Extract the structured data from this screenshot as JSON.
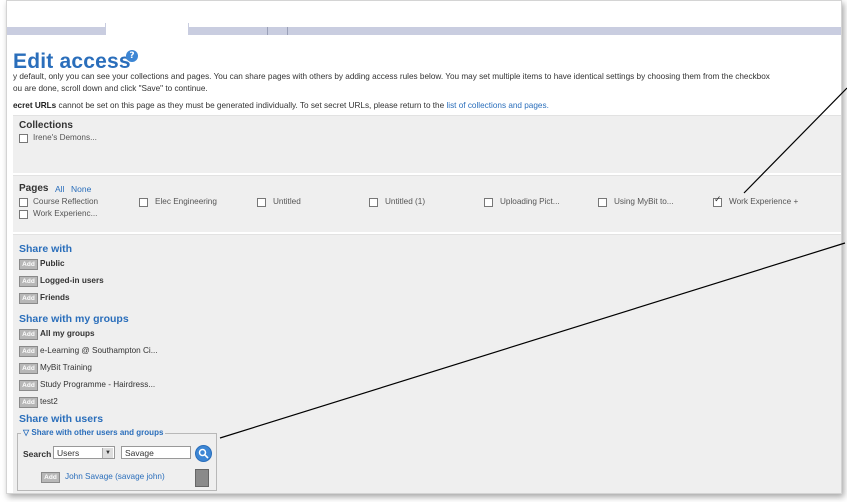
{
  "page": {
    "title": "Edit access",
    "info_icon": "?",
    "description_line1": "y default, only you can see your collections and pages. You can share pages with others by adding access rules below. You may set multiple items to have identical settings by choosing them from the checkbox",
    "description_line2": "ou are done, scroll down and click \"Save\" to continue.",
    "secret_bold": "ecret URLs",
    "secret_text": " cannot be set on this page as they must be generated individually. To set secret URLs, please return to the ",
    "secret_link": "list of collections and pages."
  },
  "collections": {
    "title": "Collections",
    "items": [
      {
        "label": "Irene's Demons...",
        "checked": false
      }
    ]
  },
  "pages": {
    "title": "Pages",
    "all_label": "All",
    "none_label": "None",
    "items": [
      {
        "label": "Course Reflection",
        "checked": false
      },
      {
        "label": "Elec Engineering",
        "checked": false
      },
      {
        "label": "Untitled",
        "checked": false
      },
      {
        "label": "Untitled (1)",
        "checked": false
      },
      {
        "label": "Uploading Pict...",
        "checked": false
      },
      {
        "label": "Using MyBit to...",
        "checked": false
      },
      {
        "label": "Work Experience +",
        "checked": true
      },
      {
        "label": "Work Experienc...",
        "checked": false
      }
    ]
  },
  "share_with": {
    "title": "Share with",
    "add_label": "Add",
    "items": [
      "Public",
      "Logged-in users",
      "Friends"
    ]
  },
  "share_groups": {
    "title": "Share with my groups",
    "items": [
      "All my groups",
      "e-Learning @ Southampton Ci...",
      "MyBit Training",
      "Study Programme - Hairdress...",
      "test2"
    ]
  },
  "share_users": {
    "title": "Share with users",
    "legend": "Share with other users and groups",
    "search_label": "Search",
    "search_type": "Users",
    "search_value": "Savage",
    "result_label": "John Savage (savage john)"
  },
  "icons": {
    "info": "info-icon",
    "search": "search-icon",
    "dropdown": "chevron-down-icon",
    "avatar": "avatar-icon"
  },
  "colors": {
    "accent": "#2a6ebb",
    "panel": "#efefef"
  }
}
